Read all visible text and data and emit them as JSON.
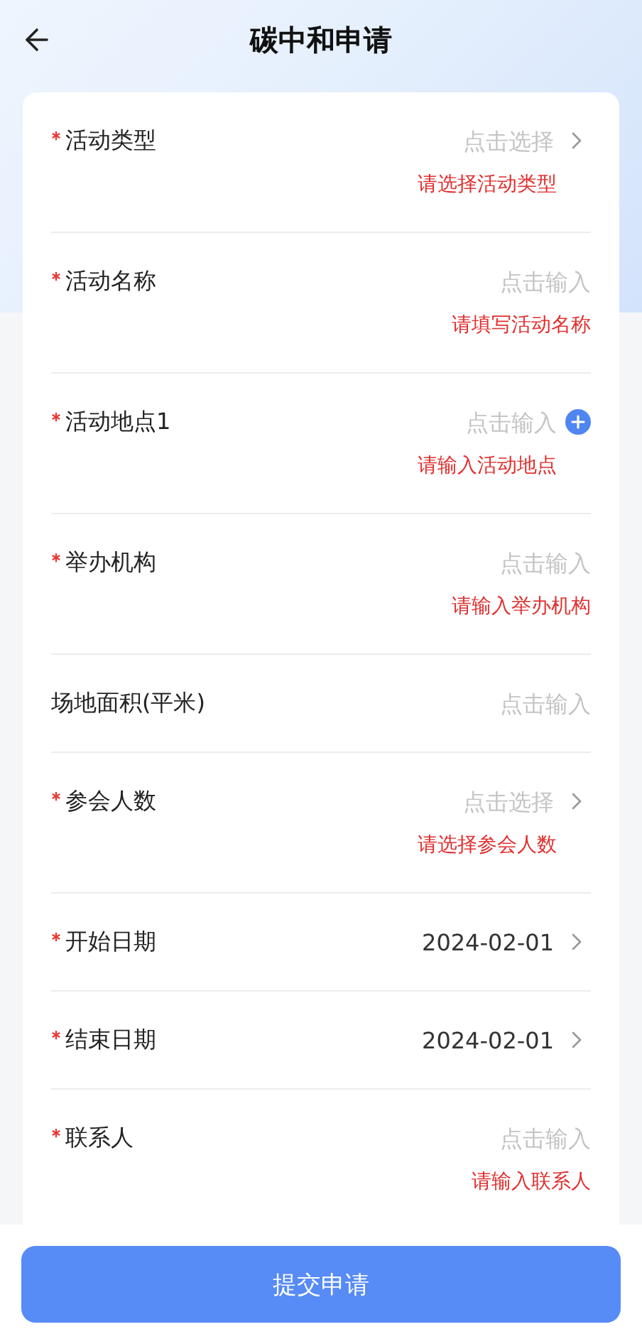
{
  "header": {
    "title": "碳中和申请"
  },
  "fields": [
    {
      "label": "活动类型",
      "required": true,
      "kind": "select",
      "placeholder": "点击选择",
      "error": "请选择活动类型"
    },
    {
      "label": "活动名称",
      "required": true,
      "kind": "input",
      "placeholder": "点击输入",
      "error": "请填写活动名称"
    },
    {
      "label": "活动地点1",
      "required": true,
      "kind": "input_add",
      "placeholder": "点击输入",
      "error": "请输入活动地点"
    },
    {
      "label": "举办机构",
      "required": true,
      "kind": "input",
      "placeholder": "点击输入",
      "error": "请输入举办机构"
    },
    {
      "label": "场地面积(平米)",
      "required": false,
      "kind": "input",
      "placeholder": "点击输入"
    },
    {
      "label": "参会人数",
      "required": true,
      "kind": "select",
      "placeholder": "点击选择",
      "error": "请选择参会人数"
    },
    {
      "label": "开始日期",
      "required": true,
      "kind": "select",
      "value": "2024-02-01"
    },
    {
      "label": "结束日期",
      "required": true,
      "kind": "select",
      "value": "2024-02-01"
    },
    {
      "label": "联系人",
      "required": true,
      "kind": "input",
      "placeholder": "点击输入",
      "error": "请输入联系人"
    }
  ],
  "submit_button": "提交申请"
}
